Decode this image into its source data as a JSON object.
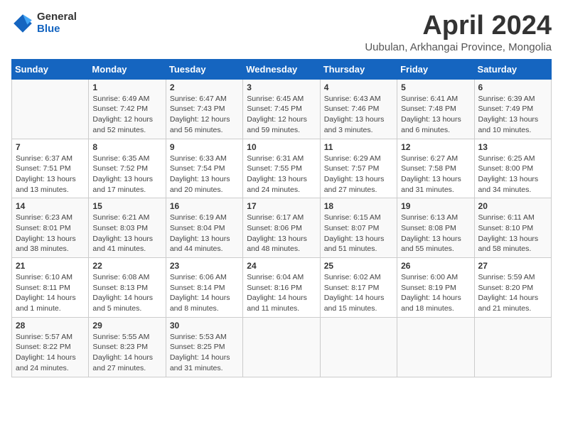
{
  "logo": {
    "general": "General",
    "blue": "Blue"
  },
  "title": "April 2024",
  "subtitle": "Uubulan, Arkhangai Province, Mongolia",
  "header_days": [
    "Sunday",
    "Monday",
    "Tuesday",
    "Wednesday",
    "Thursday",
    "Friday",
    "Saturday"
  ],
  "weeks": [
    [
      {
        "day": "",
        "text": ""
      },
      {
        "day": "1",
        "text": "Sunrise: 6:49 AM\nSunset: 7:42 PM\nDaylight: 12 hours\nand 52 minutes."
      },
      {
        "day": "2",
        "text": "Sunrise: 6:47 AM\nSunset: 7:43 PM\nDaylight: 12 hours\nand 56 minutes."
      },
      {
        "day": "3",
        "text": "Sunrise: 6:45 AM\nSunset: 7:45 PM\nDaylight: 12 hours\nand 59 minutes."
      },
      {
        "day": "4",
        "text": "Sunrise: 6:43 AM\nSunset: 7:46 PM\nDaylight: 13 hours\nand 3 minutes."
      },
      {
        "day": "5",
        "text": "Sunrise: 6:41 AM\nSunset: 7:48 PM\nDaylight: 13 hours\nand 6 minutes."
      },
      {
        "day": "6",
        "text": "Sunrise: 6:39 AM\nSunset: 7:49 PM\nDaylight: 13 hours\nand 10 minutes."
      }
    ],
    [
      {
        "day": "7",
        "text": "Sunrise: 6:37 AM\nSunset: 7:51 PM\nDaylight: 13 hours\nand 13 minutes."
      },
      {
        "day": "8",
        "text": "Sunrise: 6:35 AM\nSunset: 7:52 PM\nDaylight: 13 hours\nand 17 minutes."
      },
      {
        "day": "9",
        "text": "Sunrise: 6:33 AM\nSunset: 7:54 PM\nDaylight: 13 hours\nand 20 minutes."
      },
      {
        "day": "10",
        "text": "Sunrise: 6:31 AM\nSunset: 7:55 PM\nDaylight: 13 hours\nand 24 minutes."
      },
      {
        "day": "11",
        "text": "Sunrise: 6:29 AM\nSunset: 7:57 PM\nDaylight: 13 hours\nand 27 minutes."
      },
      {
        "day": "12",
        "text": "Sunrise: 6:27 AM\nSunset: 7:58 PM\nDaylight: 13 hours\nand 31 minutes."
      },
      {
        "day": "13",
        "text": "Sunrise: 6:25 AM\nSunset: 8:00 PM\nDaylight: 13 hours\nand 34 minutes."
      }
    ],
    [
      {
        "day": "14",
        "text": "Sunrise: 6:23 AM\nSunset: 8:01 PM\nDaylight: 13 hours\nand 38 minutes."
      },
      {
        "day": "15",
        "text": "Sunrise: 6:21 AM\nSunset: 8:03 PM\nDaylight: 13 hours\nand 41 minutes."
      },
      {
        "day": "16",
        "text": "Sunrise: 6:19 AM\nSunset: 8:04 PM\nDaylight: 13 hours\nand 44 minutes."
      },
      {
        "day": "17",
        "text": "Sunrise: 6:17 AM\nSunset: 8:06 PM\nDaylight: 13 hours\nand 48 minutes."
      },
      {
        "day": "18",
        "text": "Sunrise: 6:15 AM\nSunset: 8:07 PM\nDaylight: 13 hours\nand 51 minutes."
      },
      {
        "day": "19",
        "text": "Sunrise: 6:13 AM\nSunset: 8:08 PM\nDaylight: 13 hours\nand 55 minutes."
      },
      {
        "day": "20",
        "text": "Sunrise: 6:11 AM\nSunset: 8:10 PM\nDaylight: 13 hours\nand 58 minutes."
      }
    ],
    [
      {
        "day": "21",
        "text": "Sunrise: 6:10 AM\nSunset: 8:11 PM\nDaylight: 14 hours\nand 1 minute."
      },
      {
        "day": "22",
        "text": "Sunrise: 6:08 AM\nSunset: 8:13 PM\nDaylight: 14 hours\nand 5 minutes."
      },
      {
        "day": "23",
        "text": "Sunrise: 6:06 AM\nSunset: 8:14 PM\nDaylight: 14 hours\nand 8 minutes."
      },
      {
        "day": "24",
        "text": "Sunrise: 6:04 AM\nSunset: 8:16 PM\nDaylight: 14 hours\nand 11 minutes."
      },
      {
        "day": "25",
        "text": "Sunrise: 6:02 AM\nSunset: 8:17 PM\nDaylight: 14 hours\nand 15 minutes."
      },
      {
        "day": "26",
        "text": "Sunrise: 6:00 AM\nSunset: 8:19 PM\nDaylight: 14 hours\nand 18 minutes."
      },
      {
        "day": "27",
        "text": "Sunrise: 5:59 AM\nSunset: 8:20 PM\nDaylight: 14 hours\nand 21 minutes."
      }
    ],
    [
      {
        "day": "28",
        "text": "Sunrise: 5:57 AM\nSunset: 8:22 PM\nDaylight: 14 hours\nand 24 minutes."
      },
      {
        "day": "29",
        "text": "Sunrise: 5:55 AM\nSunset: 8:23 PM\nDaylight: 14 hours\nand 27 minutes."
      },
      {
        "day": "30",
        "text": "Sunrise: 5:53 AM\nSunset: 8:25 PM\nDaylight: 14 hours\nand 31 minutes."
      },
      {
        "day": "",
        "text": ""
      },
      {
        "day": "",
        "text": ""
      },
      {
        "day": "",
        "text": ""
      },
      {
        "day": "",
        "text": ""
      }
    ]
  ]
}
